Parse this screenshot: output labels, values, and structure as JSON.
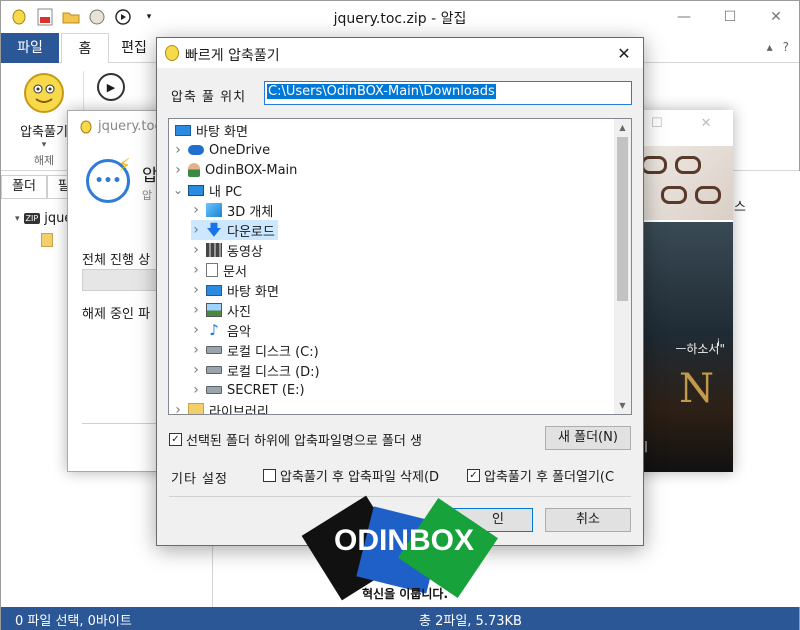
{
  "window": {
    "title": "jquery.toc.zip - 알집"
  },
  "ribbon": {
    "tabs": [
      {
        "label": "파일"
      },
      {
        "label": "홈"
      },
      {
        "label": "편집"
      }
    ],
    "extract_label": "압축풀기",
    "extract_group_label": "해제"
  },
  "left_pane": {
    "tabs": [
      {
        "label": "폴더"
      },
      {
        "label": "필"
      }
    ],
    "root_item": "jque"
  },
  "statusbar": {
    "left": "0 파일 선택, 0바이트",
    "right": "총 2파일, 5.73KB"
  },
  "progress_window": {
    "title": "jquery.toc",
    "heading": "압",
    "sub": "압",
    "progress_label": "전체 진행 상",
    "extract_label": "해제 중인 파"
  },
  "ad": {
    "text1": "스",
    "quote": "ㅡ하소서\"",
    "big_letter": "N",
    "bottom": "기"
  },
  "dialog": {
    "title": "빠르게 압축풀기",
    "path_label": "압축 풀 위치",
    "path_value": "C:\\Users\\OdinBOX-Main\\Downloads",
    "tree": [
      {
        "label": "바탕 화면",
        "icon": "desktop-icon",
        "depth": 0,
        "expander": "none"
      },
      {
        "label": "OneDrive",
        "icon": "cloud-icon",
        "depth": 1,
        "expander": "collapsed"
      },
      {
        "label": "OdinBOX-Main",
        "icon": "user-icon",
        "depth": 1,
        "expander": "collapsed"
      },
      {
        "label": "내 PC",
        "icon": "pc-icon",
        "depth": 1,
        "expander": "expanded"
      },
      {
        "label": "3D 개체",
        "icon": "cube-icon",
        "depth": 2,
        "expander": "collapsed"
      },
      {
        "label": "다운로드",
        "icon": "download-icon",
        "depth": 2,
        "expander": "collapsed",
        "selected": true
      },
      {
        "label": "동영상",
        "icon": "video-icon",
        "depth": 2,
        "expander": "collapsed"
      },
      {
        "label": "문서",
        "icon": "document-icon",
        "depth": 2,
        "expander": "collapsed"
      },
      {
        "label": "바탕 화면",
        "icon": "desktop-icon",
        "depth": 2,
        "expander": "collapsed"
      },
      {
        "label": "사진",
        "icon": "picture-icon",
        "depth": 2,
        "expander": "collapsed"
      },
      {
        "label": "음악",
        "icon": "music-icon",
        "depth": 2,
        "expander": "collapsed"
      },
      {
        "label": "로컬 디스크 (C:)",
        "icon": "drive-icon",
        "depth": 2,
        "expander": "collapsed"
      },
      {
        "label": "로컬 디스크 (D:)",
        "icon": "drive-icon",
        "depth": 2,
        "expander": "collapsed"
      },
      {
        "label": "SECRET (E:)",
        "icon": "drive-icon",
        "depth": 2,
        "expander": "collapsed"
      },
      {
        "label": "라이브러리",
        "icon": "library-icon",
        "depth": 1,
        "expander": "collapsed"
      }
    ],
    "subfolder_checkbox": {
      "label": "선택된 폴더 하위에 압축파일명으로 폴더 생",
      "checked": true
    },
    "new_folder_label": "새 폴더(N)",
    "etc_label": "기타 설정",
    "delete_checkbox": {
      "label": "압축풀기 후 압축파일 삭제(D",
      "checked": false
    },
    "open_checkbox": {
      "label": "압축풀기 후 폴더열기(C",
      "checked": true
    },
    "ok_label": "인",
    "cancel_label": "취소"
  },
  "watermark": {
    "brand": "ODINBOX",
    "tagline": "혁신을 이룹니다.",
    "colors": {
      "left": "#111111",
      "center": "#1f5fc8",
      "right": "#18a23c"
    }
  }
}
